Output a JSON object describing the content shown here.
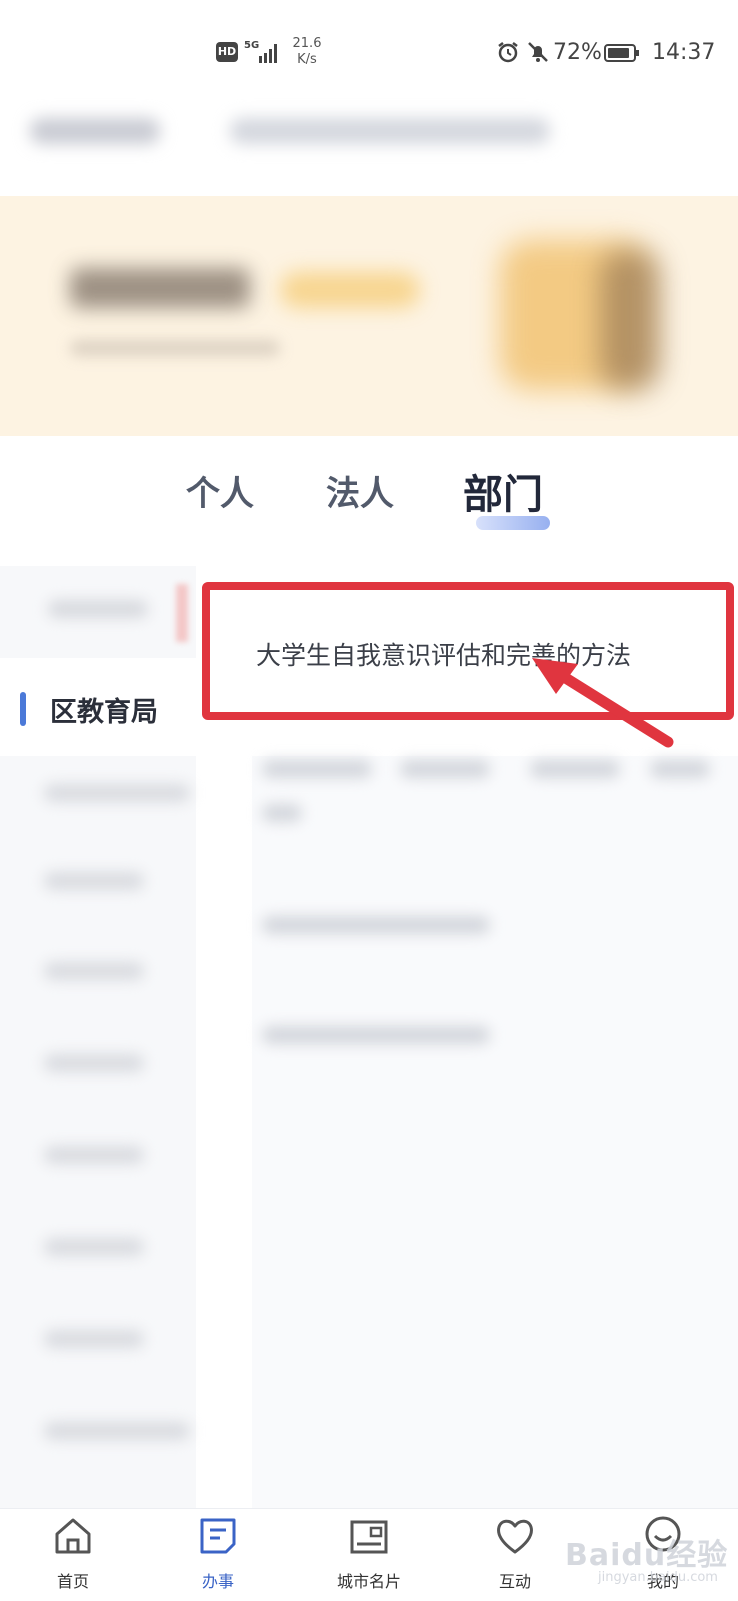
{
  "status_bar": {
    "hd_label": "HD",
    "network": "5G",
    "speed_value": "21.6",
    "speed_unit": "K/s",
    "battery_percent": "72%",
    "time": "14:37"
  },
  "tabs": [
    {
      "label": "个人",
      "active": false
    },
    {
      "label": "法人",
      "active": false
    },
    {
      "label": "部门",
      "active": true
    }
  ],
  "sidebar": {
    "active_item_label": "区教育局"
  },
  "highlight": {
    "text": "大学生自我意识评估和完善的方法",
    "color": "#e0353f"
  },
  "bottom_nav": [
    {
      "label": "首页",
      "icon": "home-icon",
      "active": false
    },
    {
      "label": "办事",
      "icon": "document-icon",
      "active": true
    },
    {
      "label": "城市名片",
      "icon": "card-icon",
      "active": false
    },
    {
      "label": "互动",
      "icon": "heart-icon",
      "active": false
    },
    {
      "label": "我的",
      "icon": "profile-icon",
      "active": false
    }
  ],
  "watermark": {
    "text": "Baidu经验",
    "sub": "jingyan.baidu.com"
  },
  "colors": {
    "accent": "#3a63c6",
    "highlight_border": "#e0353f",
    "banner_bg": "#fdf3e2"
  }
}
